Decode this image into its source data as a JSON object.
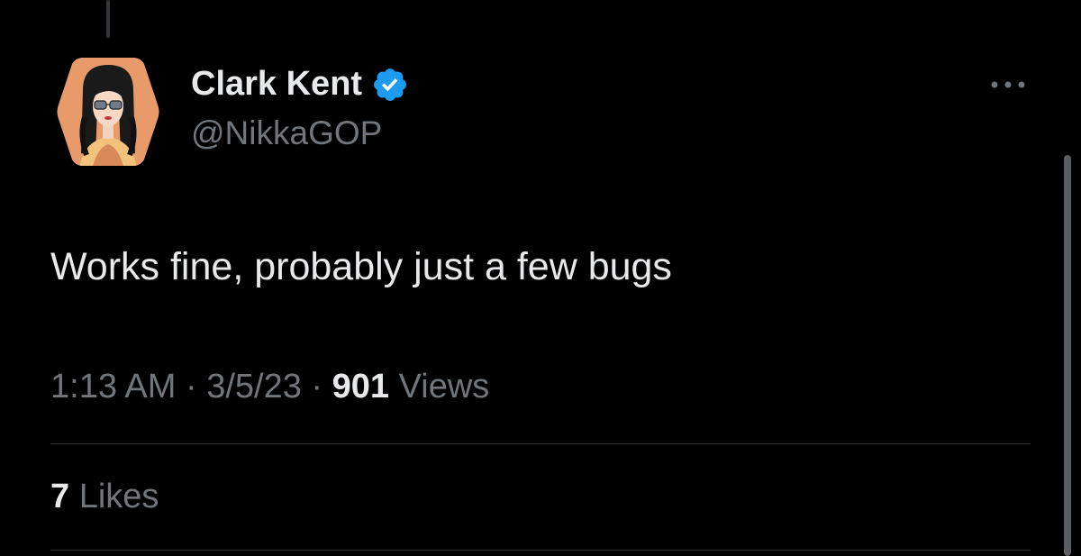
{
  "author": {
    "display_name": "Clark Kent",
    "handle": "@NikkaGOP",
    "verified": true,
    "avatar_icon": "avatar-hexagon-illustration"
  },
  "tweet": {
    "text": "Works fine, probably just a few bugs",
    "time": "1:13 AM",
    "date": "3/5/23",
    "separator": "·",
    "views_count": "901",
    "views_label": "Views"
  },
  "engagement": {
    "likes_count": "7",
    "likes_label": "Likes"
  },
  "colors": {
    "background": "#000000",
    "primary_text": "#e7e9ea",
    "secondary_text": "#71767b",
    "verified_blue": "#1d9bf0",
    "divider": "#2f3336"
  },
  "icons": {
    "verified": "verified-badge-icon",
    "more": "more-options-icon"
  }
}
